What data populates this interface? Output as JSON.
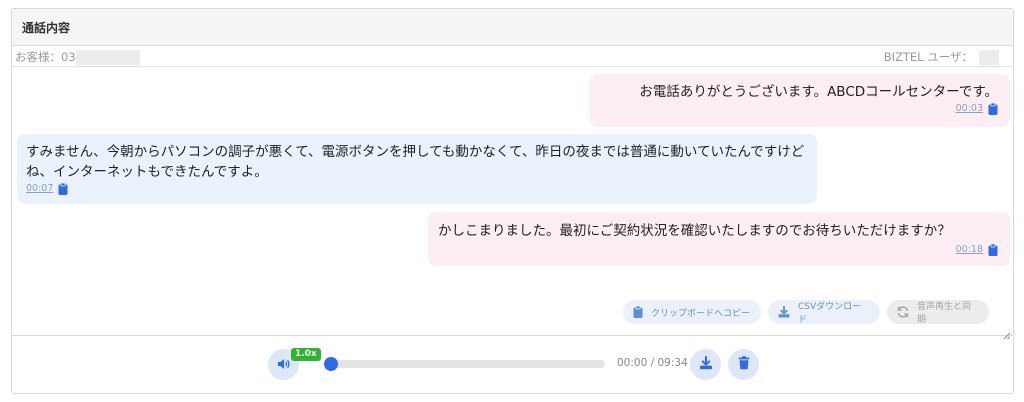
{
  "panel": {
    "title": "通話内容"
  },
  "meta": {
    "customer_label": "お客様：03",
    "user_label": "BIZTEL ユーザ："
  },
  "messages": [
    {
      "speaker": "operator",
      "text": "お電話ありがとうございます。ABCDコールセンターです。",
      "time": "00:03"
    },
    {
      "speaker": "customer",
      "text": "すみません、今朝からパソコンの調子が悪くて、電源ボタンを押しても動かなくて、昨日の夜までは普通に動いていたんですけどね、インターネットもできたんですよ。",
      "time": "00:07"
    },
    {
      "speaker": "operator",
      "text": "かしこまりました。最初にご契約状況を確認いたしますのでお待ちいただけますか？",
      "time": "00:18"
    }
  ],
  "actions": {
    "copy_label": "クリップボードへコピー",
    "csv_label": "CSVダウンロード",
    "sync_label": "音声再生と同期"
  },
  "player": {
    "speed": "1.0x",
    "current_time": "00:00",
    "separator": " / ",
    "total_time": "09:34",
    "progress": 0
  },
  "colors": {
    "operator_bubble": "#fdeef3",
    "customer_bubble": "#eaf3fd",
    "accent": "#2e6be6",
    "speed_badge": "#2db52d"
  },
  "icons": {
    "copy": "clipboard-icon",
    "csv": "download-icon",
    "sync": "sync-icon",
    "volume": "volume-icon",
    "download": "download-icon",
    "delete": "trash-icon"
  }
}
